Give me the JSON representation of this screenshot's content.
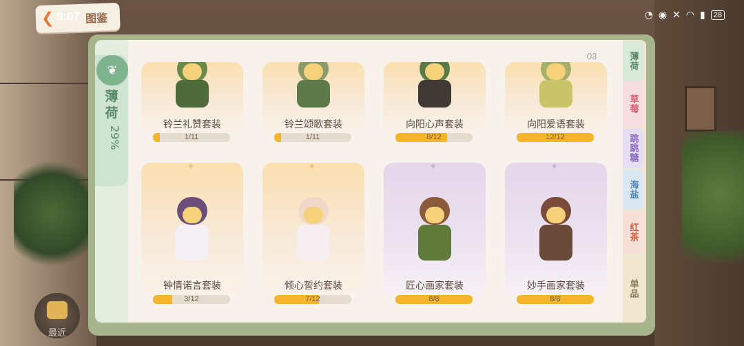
{
  "status_bar": {
    "time": "9:07",
    "battery": "28"
  },
  "header": {
    "title": "图鉴"
  },
  "series": {
    "name_line1": "薄",
    "name_line2": "荷",
    "percent": "29%"
  },
  "page_number": "03",
  "right_tabs": [
    {
      "label": "薄荷",
      "color": "#5b8a6a",
      "bg": "#d9ead9"
    },
    {
      "label": "草莓",
      "color": "#d35d6e",
      "bg": "#f6dde1"
    },
    {
      "label": "跳跳糖",
      "color": "#8a6bbf",
      "bg": "#e6dff3"
    },
    {
      "label": "海盐",
      "color": "#4f86b8",
      "bg": "#dbe8f3"
    },
    {
      "label": "红茶",
      "color": "#d0603c",
      "bg": "#f6e0d8"
    },
    {
      "label": "单品",
      "color": "#8a7a5e",
      "bg": "#f1e6d0"
    }
  ],
  "cards": [
    {
      "name": "铃兰礼赞套装",
      "progress": "1/11",
      "ratio": 0.09,
      "theme": "gold"
    },
    {
      "name": "铃兰颂歌套装",
      "progress": "1/11",
      "ratio": 0.09,
      "theme": "gold"
    },
    {
      "name": "向阳心声套装",
      "progress": "8/12",
      "ratio": 0.667,
      "theme": "gold"
    },
    {
      "name": "向阳爱语套装",
      "progress": "12/12",
      "ratio": 1.0,
      "theme": "gold"
    },
    {
      "name": "钟情诺言套装",
      "progress": "3/12",
      "ratio": 0.25,
      "theme": "gold"
    },
    {
      "name": "倾心誓约套装",
      "progress": "7/12",
      "ratio": 0.583,
      "theme": "gold"
    },
    {
      "name": "匠心画家套装",
      "progress": "8/8",
      "ratio": 1.0,
      "theme": "purple"
    },
    {
      "name": "妙手画家套装",
      "progress": "8/8",
      "ratio": 1.0,
      "theme": "purple"
    }
  ],
  "recent": {
    "label": "最近"
  }
}
